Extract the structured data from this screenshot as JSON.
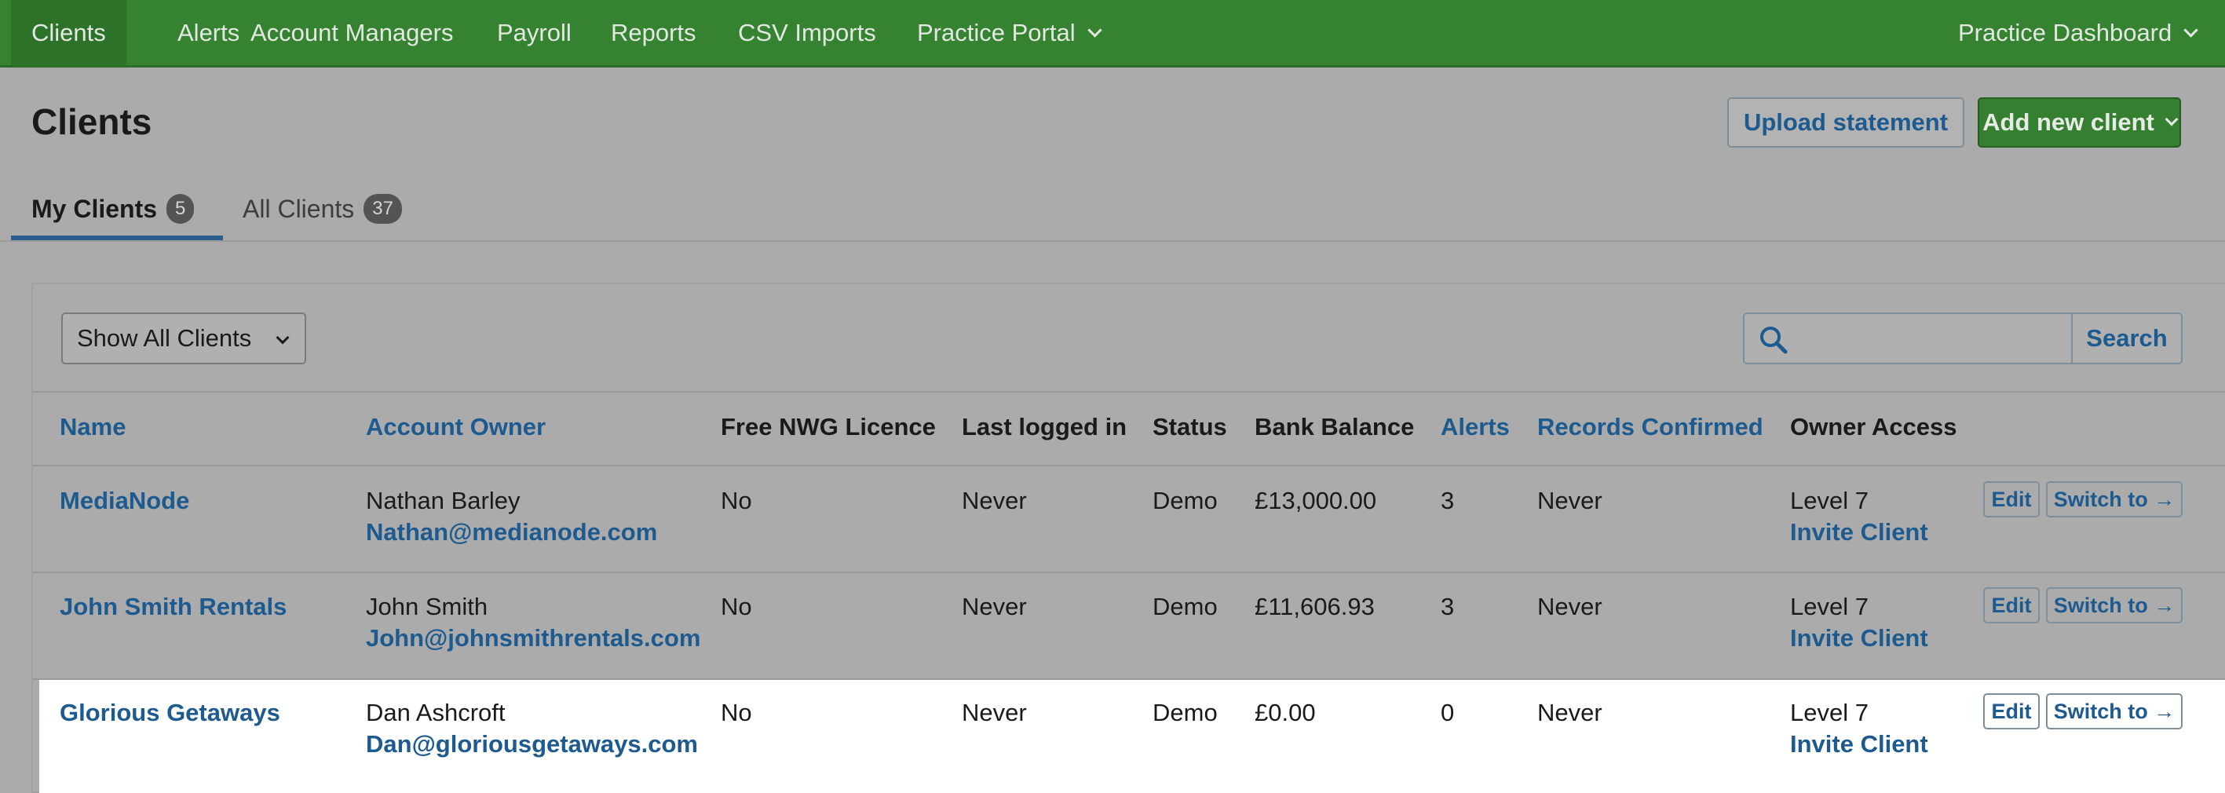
{
  "nav": {
    "items": [
      {
        "label": "Clients"
      },
      {
        "label": "Alerts"
      },
      {
        "label": "Account Managers"
      },
      {
        "label": "Payroll"
      },
      {
        "label": "Reports"
      },
      {
        "label": "CSV Imports"
      },
      {
        "label": "Practice Portal"
      }
    ],
    "right_label": "Practice Dashboard"
  },
  "page": {
    "title": "Clients",
    "upload_label": "Upload statement",
    "add_label": "Add new client"
  },
  "tabs": [
    {
      "label": "My Clients",
      "count": "5"
    },
    {
      "label": "All Clients",
      "count": "37"
    }
  ],
  "filter": {
    "selected": "Show All Clients"
  },
  "search": {
    "placeholder": "",
    "button_label": "Search"
  },
  "table": {
    "headers": {
      "name": "Name",
      "owner": "Account Owner",
      "licence": "Free NWG Licence",
      "last_login": "Last logged in",
      "status": "Status",
      "balance": "Bank Balance",
      "alerts": "Alerts",
      "records": "Records Confirmed",
      "access": "Owner Access"
    },
    "rows": [
      {
        "name": "MediaNode",
        "owner_name": "Nathan Barley",
        "owner_email": "Nathan@medianode.com",
        "licence": "No",
        "last_login": "Never",
        "status": "Demo",
        "balance": "£13,000.00",
        "alerts": "3",
        "records": "Never",
        "access_level": "Level 7",
        "invite": "Invite Client",
        "edit": "Edit",
        "switch": "Switch to →"
      },
      {
        "name": "John Smith Rentals",
        "owner_name": "John Smith",
        "owner_email": "John@johnsmithrentals.com",
        "licence": "No",
        "last_login": "Never",
        "status": "Demo",
        "balance": "£11,606.93",
        "alerts": "3",
        "records": "Never",
        "access_level": "Level 7",
        "invite": "Invite Client",
        "edit": "Edit",
        "switch": "Switch to →"
      },
      {
        "name": "Glorious Getaways",
        "owner_name": "Dan Ashcroft",
        "owner_email": "Dan@gloriousgetaways.com",
        "licence": "No",
        "last_login": "Never",
        "status": "Demo",
        "balance": "£0.00",
        "alerts": "0",
        "records": "Never",
        "access_level": "Level 7",
        "invite": "Invite Client",
        "edit": "Edit",
        "switch": "Switch to →"
      }
    ]
  }
}
